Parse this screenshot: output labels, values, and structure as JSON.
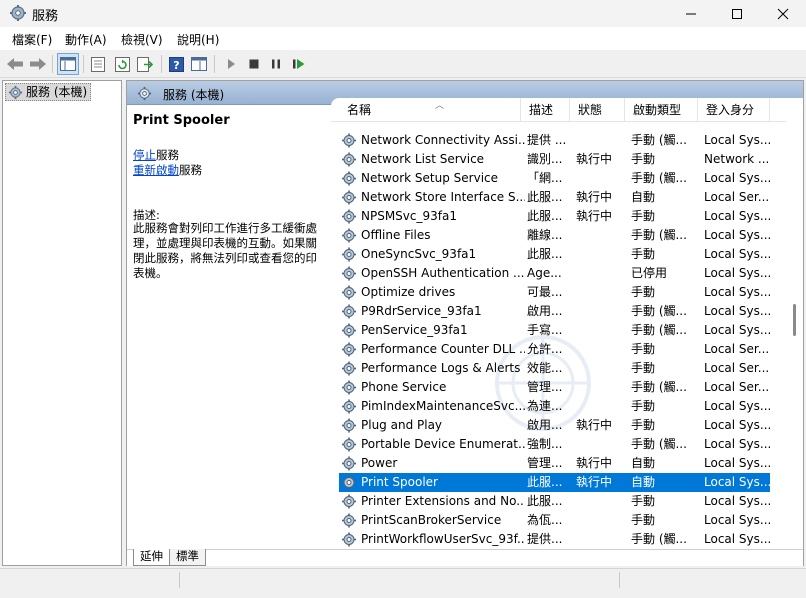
{
  "window": {
    "title": "服務"
  },
  "menu": [
    "檔案(F)",
    "動作(A)",
    "檢視(V)",
    "說明(H)"
  ],
  "tree": {
    "root_label": "服務 (本機)"
  },
  "panel": {
    "header": "服務 (本機)"
  },
  "details": {
    "service_name": "Print Spooler",
    "stop_link": "停止",
    "stop_suffix": "服務",
    "restart_link": "重新啟動",
    "restart_suffix": "服務",
    "desc_label": "描述:",
    "description": "此服務會對列印工作進行多工緩衝處理，並處理與印表機的互動。如果關閉此服務，將無法列印或查看您的印表機。"
  },
  "columns": [
    "名稱",
    "描述",
    "狀態",
    "啟動類型",
    "登入身分"
  ],
  "rows": [
    {
      "name": "Network Connectivity Assi...",
      "desc": "提供 ...",
      "status": "",
      "startup": "手動 (觸...",
      "logon": "Local Sys..."
    },
    {
      "name": "Network List Service",
      "desc": "識別...",
      "status": "執行中",
      "startup": "手動",
      "logon": "Network ..."
    },
    {
      "name": "Network Setup Service",
      "desc": "「網...",
      "status": "",
      "startup": "手動 (觸...",
      "logon": "Local Sys..."
    },
    {
      "name": "Network Store Interface S...",
      "desc": "此服...",
      "status": "執行中",
      "startup": "自動",
      "logon": "Local Ser..."
    },
    {
      "name": "NPSMSvc_93fa1",
      "desc": "此服...",
      "status": "執行中",
      "startup": "手動",
      "logon": "Local Sys..."
    },
    {
      "name": "Offline Files",
      "desc": "離線...",
      "status": "",
      "startup": "手動 (觸...",
      "logon": "Local Sys..."
    },
    {
      "name": "OneSyncSvc_93fa1",
      "desc": "此服...",
      "status": "",
      "startup": "手動",
      "logon": "Local Sys..."
    },
    {
      "name": "OpenSSH Authentication ...",
      "desc": "Age...",
      "status": "",
      "startup": "已停用",
      "logon": "Local Sys..."
    },
    {
      "name": "Optimize drives",
      "desc": "可最...",
      "status": "",
      "startup": "手動",
      "logon": "Local Sys..."
    },
    {
      "name": "P9RdrService_93fa1",
      "desc": "啟用...",
      "status": "",
      "startup": "手動 (觸...",
      "logon": "Local Sys..."
    },
    {
      "name": "PenService_93fa1",
      "desc": "手寫...",
      "status": "",
      "startup": "手動 (觸...",
      "logon": "Local Sys..."
    },
    {
      "name": "Performance Counter DLL ...",
      "desc": "允許...",
      "status": "",
      "startup": "手動",
      "logon": "Local Ser..."
    },
    {
      "name": "Performance Logs & Alerts",
      "desc": "效能...",
      "status": "",
      "startup": "手動",
      "logon": "Local Ser..."
    },
    {
      "name": "Phone Service",
      "desc": "管理...",
      "status": "",
      "startup": "手動 (觸...",
      "logon": "Local Ser..."
    },
    {
      "name": "PimIndexMaintenanceSvc...",
      "desc": "為連...",
      "status": "",
      "startup": "手動",
      "logon": "Local Sys..."
    },
    {
      "name": "Plug and Play",
      "desc": "啟用...",
      "status": "執行中",
      "startup": "手動",
      "logon": "Local Sys..."
    },
    {
      "name": "Portable Device Enumerat...",
      "desc": "強制...",
      "status": "",
      "startup": "手動 (觸...",
      "logon": "Local Sys..."
    },
    {
      "name": "Power",
      "desc": "管理...",
      "status": "執行中",
      "startup": "自動",
      "logon": "Local Sys..."
    },
    {
      "name": "Print Spooler",
      "desc": "此服...",
      "status": "執行中",
      "startup": "自動",
      "logon": "Local Sys..."
    },
    {
      "name": "Printer Extensions and No...",
      "desc": "此服...",
      "status": "",
      "startup": "手動",
      "logon": "Local Sys..."
    },
    {
      "name": "PrintScanBrokerService",
      "desc": "為佤...",
      "status": "",
      "startup": "手動",
      "logon": "Local Sys..."
    },
    {
      "name": "PrintWorkflowUserSvc_93f...",
      "desc": "提供...",
      "status": "",
      "startup": "手動 (觸...",
      "logon": "Local Sys..."
    }
  ],
  "selected_row": "Print Spooler",
  "tabs": [
    "延伸",
    "標準"
  ],
  "colors": {
    "selection": "#0078d7",
    "link": "#0044cc",
    "header_blue": "#a8bfdc"
  },
  "icons": {
    "back": "back-arrow-icon",
    "forward": "forward-arrow-icon",
    "play": "play-icon",
    "stop": "stop-icon",
    "pause": "pause-icon",
    "resume": "resume-icon"
  }
}
